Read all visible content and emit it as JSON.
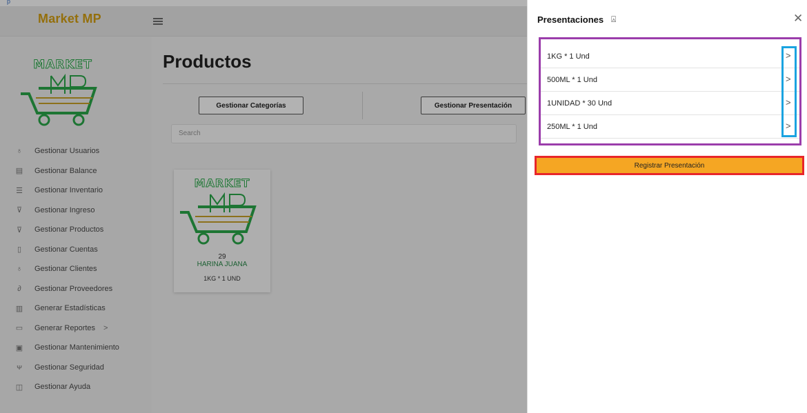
{
  "header": {
    "text": "p"
  },
  "app": {
    "brand": "Market MP",
    "logo_text": "MARKET",
    "sidebar": {
      "items": [
        {
          "label": "Gestionar Usuarios",
          "icon": "user-icon",
          "glyph": "♁"
        },
        {
          "label": "Gestionar Balance",
          "icon": "balance-icon",
          "glyph": "▤"
        },
        {
          "label": "Gestionar Inventario",
          "icon": "inventory-icon",
          "glyph": "☰"
        },
        {
          "label": "Gestionar Ingreso",
          "icon": "cart-icon",
          "glyph": "⊽"
        },
        {
          "label": "Gestionar Productos",
          "icon": "cart-icon",
          "glyph": "⊽"
        },
        {
          "label": "Gestionar Cuentas",
          "icon": "accounts-icon",
          "glyph": "▯"
        },
        {
          "label": "Gestionar Clientes",
          "icon": "user-icon",
          "glyph": "♁"
        },
        {
          "label": "Gestionar Proveedores",
          "icon": "handshake-icon",
          "glyph": "∂"
        },
        {
          "label": "Generar Estadísticas",
          "icon": "stats-icon",
          "glyph": "▥"
        },
        {
          "label": "Generar Reportes",
          "icon": "report-icon",
          "glyph": "▭",
          "chevron": ">"
        },
        {
          "label": "Gestionar Mantenimiento",
          "icon": "maintenance-icon",
          "glyph": "▣"
        },
        {
          "label": "Gestionar Seguridad",
          "icon": "security-icon",
          "glyph": "ᴪ"
        },
        {
          "label": "Gestionar Ayuda",
          "icon": "help-icon",
          "glyph": "◫"
        }
      ]
    },
    "main": {
      "title": "Productos",
      "buttons": {
        "categorias": "Gestionar Categorías",
        "presentacion": "Gestionar Presentación"
      },
      "search_placeholder": "Search",
      "product": {
        "id": "29",
        "name": "HARINA JUANA",
        "presentation": "1KG * 1 UND"
      }
    }
  },
  "drawer": {
    "title": "Presentaciones",
    "pin_icon": "pin-icon",
    "close_icon": "close-icon",
    "close_glyph": "✕",
    "items": [
      {
        "label": "1KG * 1 Und",
        "chevron": ">"
      },
      {
        "label": "500ML * 1 Und",
        "chevron": ">"
      },
      {
        "label": "1UNIDAD * 30 Und",
        "chevron": ">"
      },
      {
        "label": "250ML * 1 Und",
        "chevron": ">"
      }
    ],
    "register_button": "Registrar Presentación"
  },
  "colors": {
    "brand": "#d4a012",
    "register_button": "#f5a623",
    "highlight_purple": "#9b3dab",
    "highlight_blue": "#1aa3e0",
    "highlight_red": "#e8262a",
    "logo_green": "#2aa84a"
  }
}
